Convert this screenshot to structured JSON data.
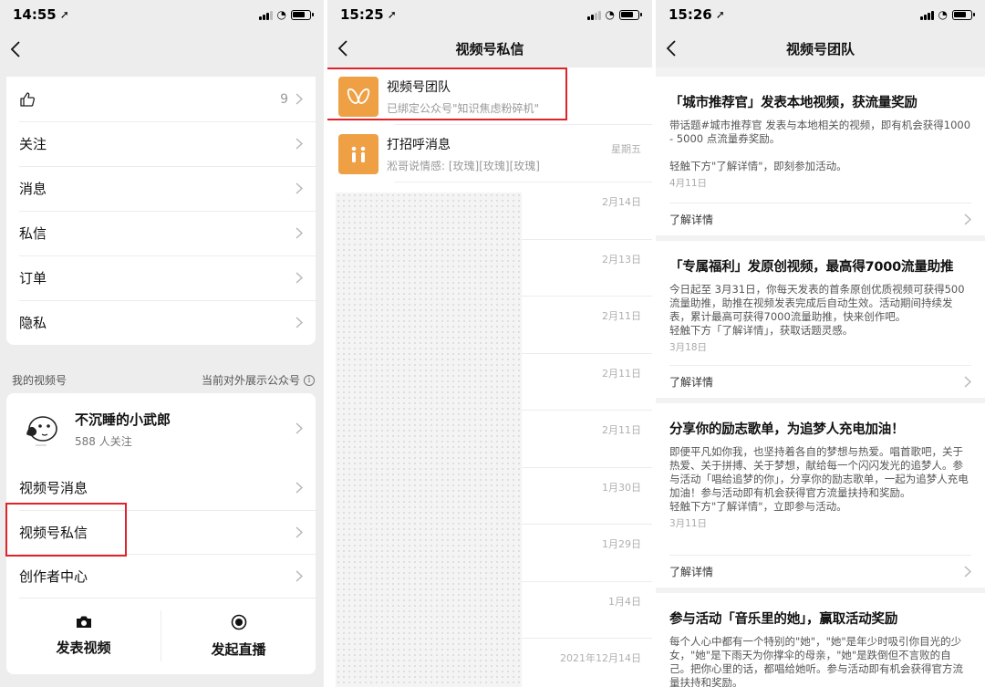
{
  "panel1": {
    "status": {
      "time": "14:55"
    },
    "top_items": [
      {
        "label": "",
        "icon": "thumbs-up-icon",
        "value": "9"
      },
      {
        "label": "关注"
      },
      {
        "label": "消息"
      },
      {
        "label": "私信"
      },
      {
        "label": "订单"
      },
      {
        "label": "隐私"
      }
    ],
    "section_label": "我的视频号",
    "section_right": "当前对外展示公众号",
    "profile": {
      "name": "不沉睡的小武郎",
      "followers": "588 人关注"
    },
    "menu": [
      "视频号消息",
      "视频号私信",
      "创作者中心"
    ],
    "actions": [
      {
        "label": "发表视频",
        "icon": "camera-icon"
      },
      {
        "label": "发起直播",
        "icon": "live-record-icon"
      }
    ]
  },
  "panel2": {
    "status": {
      "time": "15:25"
    },
    "title": "视频号私信",
    "messages": [
      {
        "name": "视频号团队",
        "preview": "已绑定公众号\"知识焦虑粉碎机\"",
        "date": "",
        "icon": "channels-butterfly-icon"
      },
      {
        "name": "打招呼消息",
        "preview": "淞哥说情感: [玫瑰][玫瑰][玫瑰]",
        "date": "星期五",
        "icon": "greeting-icon"
      }
    ],
    "blurred_dates": [
      "2月14日",
      "2月13日",
      "2月11日",
      "2月11日",
      "2月11日",
      "1月30日",
      "1月29日",
      "1月4日",
      "2021年12月14日"
    ]
  },
  "panel3": {
    "status": {
      "time": "15:26"
    },
    "title": "视频号团队",
    "more_label": "了解详情",
    "articles": [
      {
        "title": "「城市推荐官」发表本地视频，获流量奖励",
        "body": [
          "带话题#城市推荐官 发表与本地相关的视频，即有机会获得1000 - 5000 点流量券奖励。",
          "",
          "轻触下方\"了解详情\"，即刻参加活动。"
        ],
        "date": "4月11日"
      },
      {
        "title": "「专属福利」发原创视频，最高得7000流量助推",
        "body": [
          "今日起至 3月31日，你每天发表的首条原创优质视频可获得500流量助推，助推在视频发表完成后自动生效。活动期间持续发表，累计最高可获得7000流量助推，快来创作吧。",
          "轻触下方「了解详情」，获取话题灵感。"
        ],
        "date": "3月18日"
      },
      {
        "title": "分享你的励志歌单，为追梦人充电加油！",
        "body": [
          "即便平凡如你我，也坚持着各自的梦想与热爱。唱首歌吧，关于热爱、关于拼搏、关于梦想，献给每一个闪闪发光的追梦人。参与活动「唱给追梦的你」，分享你的励志歌单，一起为追梦人充电加油！参与活动即有机会获得官方流量扶持和奖励。",
          "轻触下方\"了解详情\"，立即参与活动。"
        ],
        "date": "3月11日"
      },
      {
        "title": "参与活动「音乐里的她」，赢取活动奖励",
        "body": [
          "每个人心中都有一个特别的\"她\"，\"她\"是年少时吸引你目光的少女，\"她\"是下雨天为你撑伞的母亲，\"她\"是跌倒但不言败的自己。把你心里的话，都唱给她听。参与活动即有机会获得官方流量扶持和奖励。"
        ],
        "date": ""
      }
    ]
  }
}
